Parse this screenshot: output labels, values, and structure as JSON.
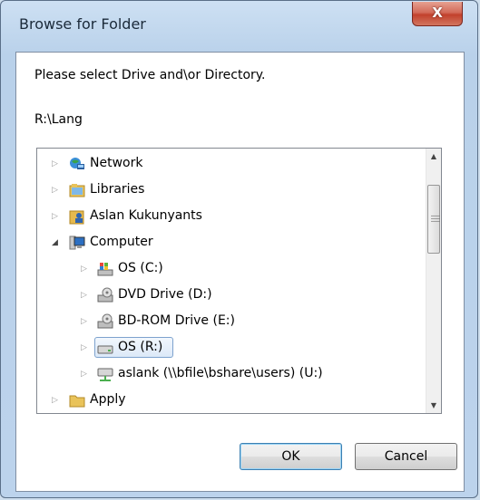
{
  "window": {
    "title": "Browse for Folder",
    "close_label": "X"
  },
  "dialog": {
    "prompt": "Please select Drive and\\or Directory.",
    "current_path": "R:\\Lang"
  },
  "tree": {
    "items": [
      {
        "label": "Network",
        "icon": "network-icon",
        "level": 0,
        "expanded": false
      },
      {
        "label": "Libraries",
        "icon": "libraries-icon",
        "level": 0,
        "expanded": false
      },
      {
        "label": "Aslan Kukunyants",
        "icon": "user-folder-icon",
        "level": 0,
        "expanded": false
      },
      {
        "label": "Computer",
        "icon": "computer-icon",
        "level": 0,
        "expanded": true
      },
      {
        "label": "OS (C:)",
        "icon": "system-drive-icon",
        "level": 1,
        "expanded": false
      },
      {
        "label": "DVD Drive (D:)",
        "icon": "dvd-drive-icon",
        "level": 1,
        "expanded": false
      },
      {
        "label": "BD-ROM Drive (E:)",
        "icon": "bdrom-drive-icon",
        "level": 1,
        "expanded": false
      },
      {
        "label": "OS (R:)",
        "icon": "hard-drive-icon",
        "level": 1,
        "expanded": false,
        "selected": true
      },
      {
        "label": "aslank (\\\\bfile\\bshare\\users) (U:)",
        "icon": "network-drive-icon",
        "level": 1,
        "expanded": false
      },
      {
        "label": "Apply",
        "icon": "folder-icon",
        "level": 0,
        "expanded": false
      }
    ]
  },
  "buttons": {
    "ok": "OK",
    "cancel": "Cancel"
  }
}
